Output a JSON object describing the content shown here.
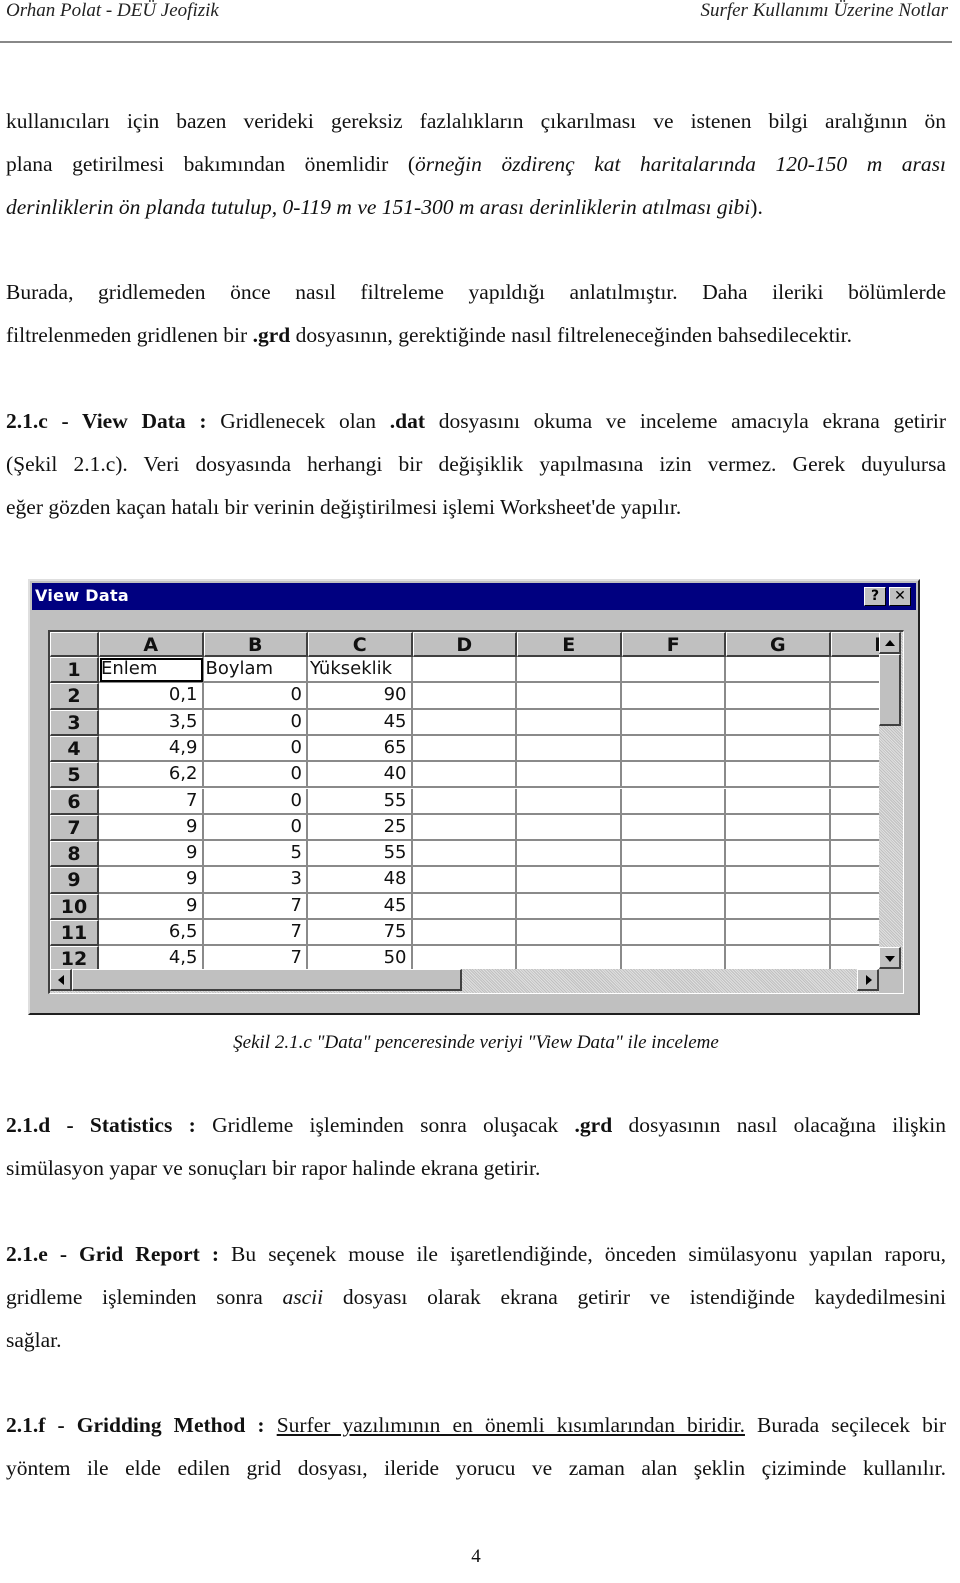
{
  "header": {
    "left": "Orhan Polat - DEÜ Jeofizik",
    "right": "Surfer Kullanımı Üzerine Notlar"
  },
  "intro": {
    "line1": "kullanıcıları için bazen verideki gereksiz fazlalıkların çıkarılması ve istenen bilgi aralığının ön",
    "line2_a": "plana getirilmesi bakımından önemlidir (",
    "line2_i": "örneğin özdirenç kat haritalarında 120-150 m   arası",
    "line3_i": "derinliklerin ön planda tutulup, 0-119 m ve 151-300 m arası derinliklerin atılması gibi",
    "line3_b": ")."
  },
  "filter_para": {
    "line1": "Burada, gridlemeden önce nasıl filtreleme yapıldığı anlatılmıştır. Daha ileriki bölümlerde",
    "line2_a": "filtrelenmeden gridlenen bir ",
    "line2_b": ".grd",
    "line2_c": " dosyasının, gerektiğinde nasıl filtreleneceğinden bahsedilecektir."
  },
  "section_c": {
    "heading": "2.1.c - View Data :",
    "line1_a": " Gridlenecek olan ",
    "line1_b": ".dat",
    "line1_c": " dosyasını okuma ve inceleme amacıyla ekrana getirir",
    "line2": "(Şekil 2.1.c). Veri dosyasında herhangi bir değişiklik yapılmasına izin vermez. Gerek duyulursa",
    "line3": "eğer gözden kaçan hatalı bir verinin değiştirilmesi işlemi Worksheet'de yapılır."
  },
  "window": {
    "title": "View Data",
    "help_button": "?",
    "close_button": "✕",
    "columns": [
      "A",
      "B",
      "C",
      "D",
      "E",
      "F",
      "G",
      "H"
    ],
    "rows": [
      {
        "num": "1",
        "cells": [
          "Enlem",
          "Boylam",
          "Yükseklik"
        ]
      },
      {
        "num": "2",
        "cells": [
          "0,1",
          "0",
          "90"
        ]
      },
      {
        "num": "3",
        "cells": [
          "3,5",
          "0",
          "45"
        ]
      },
      {
        "num": "4",
        "cells": [
          "4,9",
          "0",
          "65"
        ]
      },
      {
        "num": "5",
        "cells": [
          "6,2",
          "0",
          "40"
        ]
      },
      {
        "num": "6",
        "cells": [
          "7",
          "0",
          "55"
        ]
      },
      {
        "num": "7",
        "cells": [
          "9",
          "0",
          "25"
        ]
      },
      {
        "num": "8",
        "cells": [
          "9",
          "5",
          "55"
        ]
      },
      {
        "num": "9",
        "cells": [
          "9",
          "3",
          "48"
        ]
      },
      {
        "num": "10",
        "cells": [
          "9",
          "7",
          "45"
        ]
      },
      {
        "num": "11",
        "cells": [
          "6,5",
          "7",
          "75"
        ]
      },
      {
        "num": "12",
        "cells": [
          "4,5",
          "7",
          "50"
        ]
      }
    ],
    "active_cell": "A1"
  },
  "caption": "Şekil 2.1.c \"Data\" penceresinde veriyi \"View Data\" ile inceleme",
  "section_d": {
    "heading": "2.1.d - Statistics :",
    "line1_a": " Gridleme işleminden sonra oluşacak ",
    "line1_b": ".grd",
    "line1_c": " dosyasının nasıl olacağına ilişkin",
    "line2": "simülasyon yapar ve sonuçları bir rapor halinde ekrana getirir."
  },
  "section_e": {
    "heading": "2.1.e - Grid Report :",
    "line1": " Bu seçenek mouse ile işaretlendiğinde, önceden simülasyonu yapılan raporu,",
    "line2_a": "gridleme işleminden sonra ",
    "line2_i": "ascii",
    "line2_c": " dosyası olarak ekrana getirir ve istendiğinde kaydedilmesini",
    "line3": "sağlar."
  },
  "section_f": {
    "heading": "2.1.f - Gridding Method :",
    "line1_u": "Surfer yazılımının en önemli kısımlarından biridir.",
    "line1_c": " Burada seçilecek bir",
    "line2": "yöntem ile elde edilen grid dosyası, ileride yorucu ve zaman alan şeklin çiziminde kullanılır."
  },
  "page_number": "4"
}
